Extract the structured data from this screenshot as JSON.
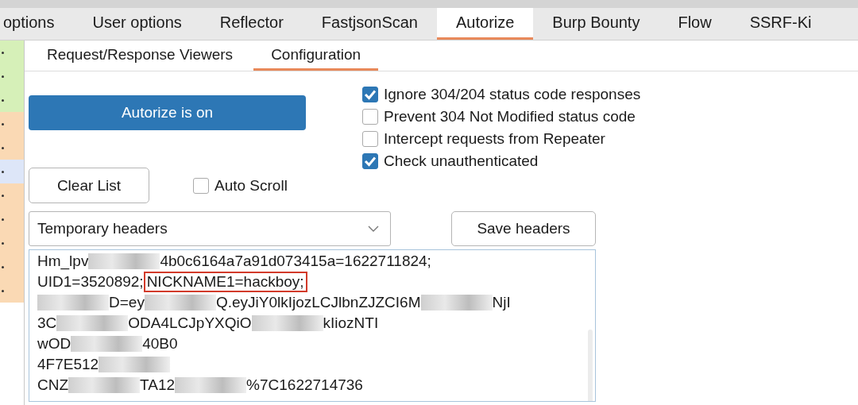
{
  "tabs": [
    {
      "label": "options",
      "selected": false
    },
    {
      "label": "User options",
      "selected": false
    },
    {
      "label": "Reflector",
      "selected": false
    },
    {
      "label": "FastjsonScan",
      "selected": false
    },
    {
      "label": "Autorize",
      "selected": true
    },
    {
      "label": "Burp Bounty",
      "selected": false
    },
    {
      "label": "Flow",
      "selected": false
    },
    {
      "label": "SSRF-Ki",
      "selected": false
    }
  ],
  "subtabs": [
    {
      "label": "Request/Response Viewers",
      "selected": false
    },
    {
      "label": "Configuration",
      "selected": true
    }
  ],
  "toggle_button": {
    "label": "Autorize is on",
    "on": true
  },
  "options": [
    {
      "label": "Ignore 304/204 status code responses",
      "checked": true
    },
    {
      "label": "Prevent 304 Not Modified status code",
      "checked": false
    },
    {
      "label": "Intercept requests from Repeater",
      "checked": false
    },
    {
      "label": "Check unauthenticated",
      "checked": true
    }
  ],
  "clear_button": "Clear List",
  "auto_scroll": {
    "label": "Auto Scroll",
    "checked": false
  },
  "headers_dropdown": {
    "value": "Temporary headers"
  },
  "save_button": "Save headers",
  "header_lines": [
    [
      {
        "kind": "text",
        "text": "Hm_lpv"
      },
      {
        "kind": "redacted"
      },
      {
        "kind": "text",
        "text": "4b0c6164a7a91d073415a=1622711824;"
      }
    ],
    [
      {
        "kind": "text",
        "text": "UID1=3520892;"
      },
      {
        "kind": "highlight",
        "text": "NICKNAME1=hackboy;"
      }
    ],
    [
      {
        "kind": "redacted"
      },
      {
        "kind": "text",
        "text": "D=ey"
      },
      {
        "kind": "redacted"
      },
      {
        "kind": "text",
        "text": "Q.eyJiY0lkIjozLCJlbnZJZCI6M"
      },
      {
        "kind": "redacted"
      },
      {
        "kind": "text",
        "text": "NjI"
      }
    ],
    [
      {
        "kind": "text",
        "text": "3C"
      },
      {
        "kind": "redacted"
      },
      {
        "kind": "text",
        "text": "ODA4LCJpYXQiO"
      },
      {
        "kind": "redacted"
      },
      {
        "kind": "text",
        "text": "kIiozNTI"
      }
    ],
    [
      {
        "kind": "text",
        "text": "wOD"
      },
      {
        "kind": "redacted"
      },
      {
        "kind": "text",
        "text": "40B0"
      }
    ],
    [
      {
        "kind": "text",
        "text": "4F7E512"
      },
      {
        "kind": "redacted"
      }
    ],
    [
      {
        "kind": "text",
        "text": "CNZ"
      },
      {
        "kind": "redacted"
      },
      {
        "kind": "text",
        "text": "TA12"
      },
      {
        "kind": "redacted"
      },
      {
        "kind": "text",
        "text": "%7C1622714736"
      }
    ]
  ]
}
